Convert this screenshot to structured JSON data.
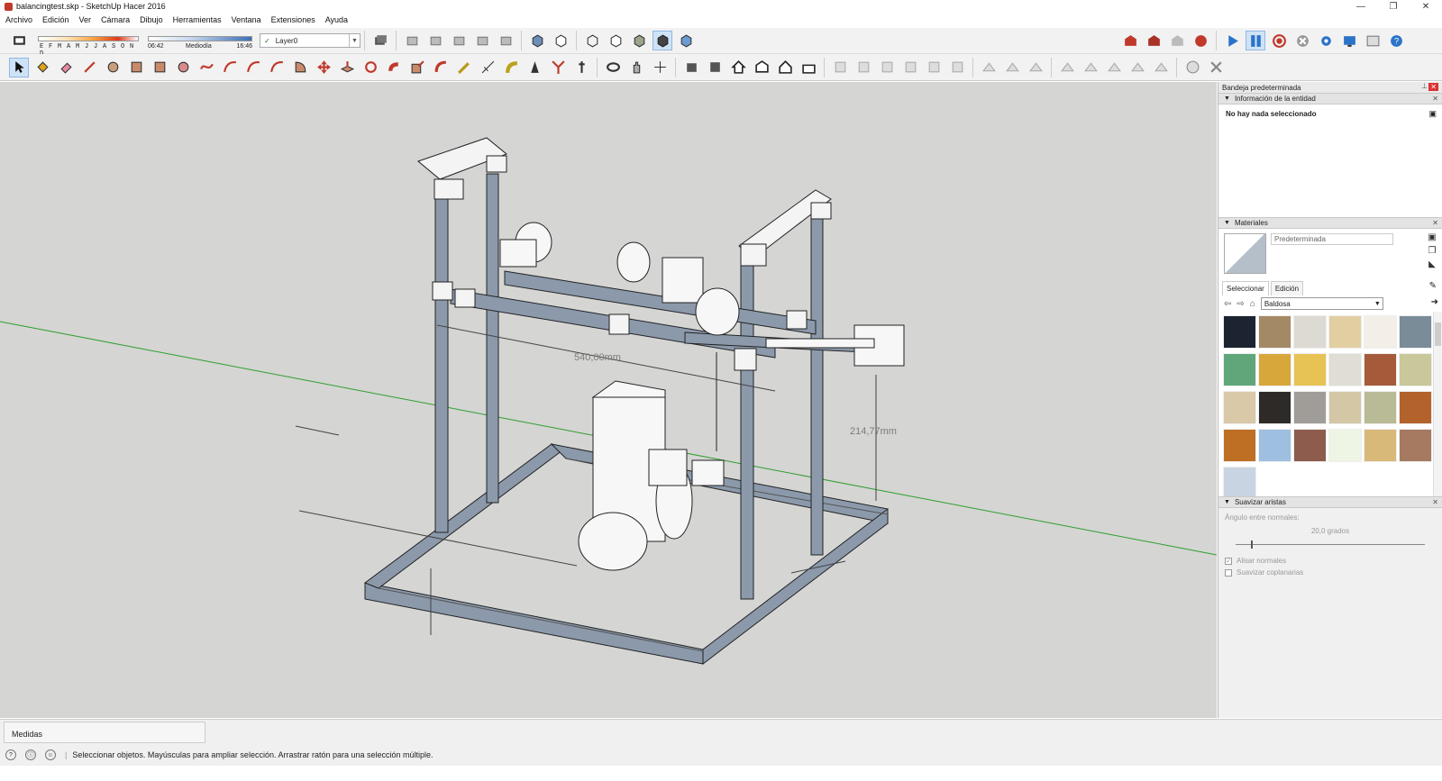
{
  "window": {
    "title": "balancingtest.skp - SketchUp Hacer 2016",
    "controls": [
      "—",
      "❐",
      "✕"
    ]
  },
  "menu": [
    "Archivo",
    "Edición",
    "Ver",
    "Cámara",
    "Dibujo",
    "Herramientas",
    "Ventana",
    "Extensiones",
    "Ayuda"
  ],
  "shadows": {
    "months": "E F M A M J J A S O N D",
    "time_start": "06:42",
    "time_mid": "Mediodía",
    "time_end": "16:46"
  },
  "layer": {
    "check": "✓",
    "name": "Layer0"
  },
  "viewport": {
    "dimension_1": "540,00mm",
    "dimension_2": "214,77mm",
    "colors": {
      "background": "#d5d5d3",
      "frame": "#8b99ab",
      "axis_green": "#2e9e2e"
    }
  },
  "tray": {
    "title": "Bandeja predeterminada",
    "entity_info": {
      "heading": "Información de la entidad",
      "message": "No hay nada seleccionado"
    },
    "materials": {
      "heading": "Materiales",
      "current": "Predeterminada",
      "tabs": [
        "Seleccionar",
        "Edición"
      ],
      "library": "Baldosa",
      "swatch_colors": [
        "#1c2431",
        "#a48a64",
        "#dcdad2",
        "#e2cfa1",
        "#f3efe8",
        "#7a8c98",
        "#5fa77b",
        "#d7a73c",
        "#e7c255",
        "#e0ddd4",
        "#a55b3a",
        "#c8c89a",
        "#d9c9a9",
        "#2d2a28",
        "#a09c98",
        "#d3c7a6",
        "#b8bb96",
        "#b2622a",
        "#bf6f24",
        "#9fbfe0",
        "#8d5c4c",
        "#eef5e5",
        "#d8b97a",
        "#a57a60",
        "#c9d4e2"
      ]
    },
    "smooth": {
      "heading": "Suavizar aristas",
      "angle_label": "Ángulo entre normales:",
      "angle_value": "20,0  grados",
      "angle_fraction": 0.08,
      "option_1": "Alisar normales",
      "option_2": "Suavizar coplanarias",
      "option_1_checked": "✓"
    }
  },
  "measurements": {
    "label": "Medidas"
  },
  "status": {
    "message": "Seleccionar objetos. Mayúsculas para ampliar selección. Arrastrar ratón para una selección múltiple.",
    "icons": [
      "?",
      "ⓘ",
      "☺"
    ]
  }
}
